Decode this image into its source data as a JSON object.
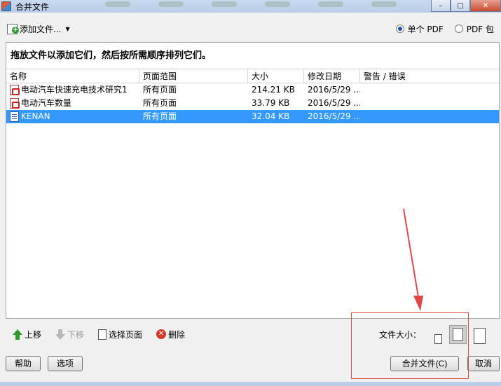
{
  "window": {
    "title": "合并文件",
    "min_glyph": "–",
    "max_glyph": "□",
    "close_glyph": "✕"
  },
  "toolbar": {
    "add_files_label": "添加文件...",
    "caret": "▼",
    "output_options": [
      {
        "label": "单个 PDF",
        "selected": true
      },
      {
        "label": "PDF 包",
        "selected": false
      }
    ]
  },
  "panel": {
    "instruction": "拖放文件以添加它们，然后按所需顺序排列它们。",
    "columns": [
      "名称",
      "页面范围",
      "大小",
      "修改日期",
      "警告 / 错误"
    ],
    "rows": [
      {
        "icon": "pdf-icon",
        "name": "电动汽车快速充电技术研究1",
        "range": "所有页面",
        "size": "214.21 KB",
        "date": "2016/5/29 ...",
        "warning": "",
        "selected": false
      },
      {
        "icon": "pdf-icon",
        "name": "电动汽车数量",
        "range": "所有页面",
        "size": "33.79 KB",
        "date": "2016/5/29 ...",
        "warning": "",
        "selected": false
      },
      {
        "icon": "doc-icon",
        "name": "KENAN",
        "range": "所有页面",
        "size": "32.04 KB",
        "date": "2016/5/29 ...",
        "warning": "",
        "selected": true
      }
    ]
  },
  "lower_toolbar": {
    "move_up": "上移",
    "move_down": "下移",
    "select_pages": "选择页面",
    "delete": "删除",
    "delete_glyph": "✕",
    "file_size_label": "文件大小："
  },
  "bottom": {
    "help": "帮助",
    "options": "选项",
    "merge": "合并文件(C)",
    "cancel": "取消"
  },
  "colors": {
    "selection": "#3399ff",
    "annotation": "#e04848"
  }
}
